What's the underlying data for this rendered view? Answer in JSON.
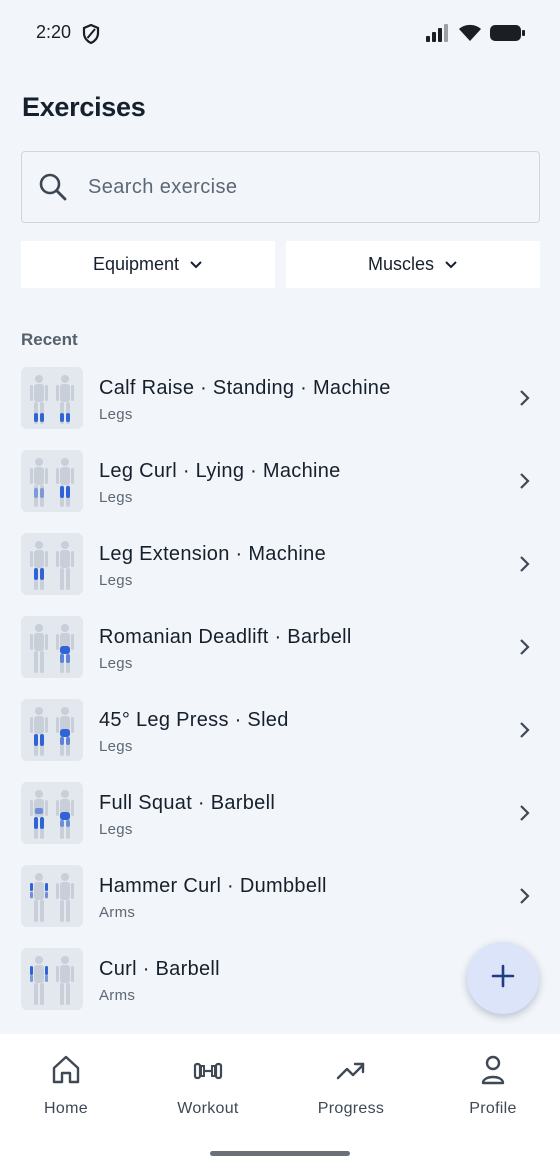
{
  "status_bar": {
    "time": "2:20"
  },
  "header": {
    "title": "Exercises"
  },
  "search": {
    "placeholder": "Search exercise"
  },
  "filters": {
    "equipment_label": "Equipment",
    "muscles_label": "Muscles"
  },
  "section": {
    "recent_label": "Recent"
  },
  "exercises": [
    {
      "title": "Calf Raise · Standing · Machine",
      "category": "Legs"
    },
    {
      "title": "Leg Curl · Lying · Machine",
      "category": "Legs"
    },
    {
      "title": "Leg Extension · Machine",
      "category": "Legs"
    },
    {
      "title": "Romanian Deadlift · Barbell",
      "category": "Legs"
    },
    {
      "title": "45° Leg Press · Sled",
      "category": "Legs"
    },
    {
      "title": "Full Squat · Barbell",
      "category": "Legs"
    },
    {
      "title": "Hammer Curl · Dumbbell",
      "category": "Arms"
    },
    {
      "title": "Curl · Barbell",
      "category": "Arms"
    }
  ],
  "bottom_nav": [
    {
      "label": "Home",
      "icon": "home-icon"
    },
    {
      "label": "Workout",
      "icon": "dumbbell-icon"
    },
    {
      "label": "Progress",
      "icon": "trending-up-icon"
    },
    {
      "label": "Profile",
      "icon": "person-icon"
    }
  ],
  "colors": {
    "accent": "#2b4fa8",
    "highlight_muscle": "#2f63d8",
    "fab_bg": "#dbe4f8",
    "background": "#f2f5f9"
  }
}
